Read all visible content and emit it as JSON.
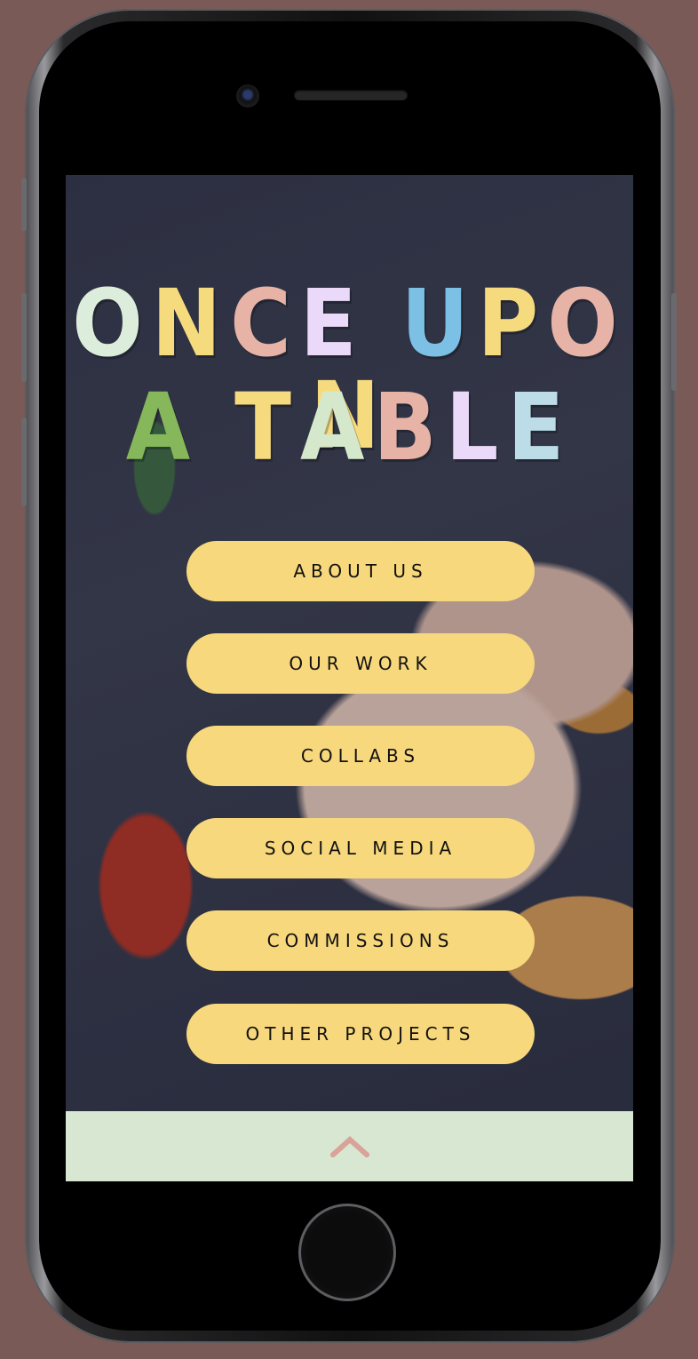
{
  "site": {
    "title_line1": [
      "O",
      "N",
      "C",
      "E",
      " ",
      "U",
      "P",
      "O",
      "N"
    ],
    "title_line2": [
      "A",
      " ",
      "T",
      "A",
      "B",
      "L",
      "E"
    ],
    "title_line1_colors": [
      "#dceedb",
      "#f6da7e",
      "#e6b3a6",
      "#ead9f8",
      "",
      "#7cc0e6",
      "#f6da7e",
      "#e6b3a6",
      "#f6da7e"
    ],
    "title_line2_colors": [
      "#86b75a",
      "",
      "#f6da7e",
      "#d6e8cc",
      "#e6b3a6",
      "#ead9f8",
      "#bcdde7"
    ]
  },
  "nav": {
    "items": [
      {
        "label": "ABOUT US"
      },
      {
        "label": "OUR WORK"
      },
      {
        "label": "COLLABS"
      },
      {
        "label": "SOCIAL MEDIA"
      },
      {
        "label": "COMMISSIONS"
      },
      {
        "label": "OTHER PROJECTS"
      }
    ]
  },
  "footer": {
    "icon": "chevron-up-icon",
    "icon_color": "#d9a39a",
    "background": "#d8e7d1"
  },
  "colors": {
    "button": "#f8d87c",
    "device_bg": "#7a5a57"
  }
}
